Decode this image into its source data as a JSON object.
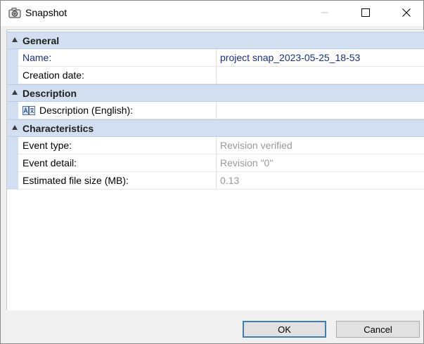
{
  "window": {
    "title": "Snapshot"
  },
  "grid": {
    "general": {
      "label": "General",
      "name_label": "Name:",
      "name_value": "project snap_2023-05-25_18-53",
      "creation_label": "Creation date:",
      "creation_value": ""
    },
    "description": {
      "label": "Description",
      "desc_label": "Description (English):",
      "desc_value": ""
    },
    "characteristics": {
      "label": "Characteristics",
      "event_type_label": "Event type:",
      "event_type_value": "Revision verified",
      "event_detail_label": "Event detail:",
      "event_detail_value": "Revision \"0\"",
      "file_size_label": "Estimated file size (MB):",
      "file_size_value": "0.13"
    }
  },
  "footer": {
    "ok_label": "OK",
    "cancel_label": "Cancel"
  },
  "colors": {
    "category_band": "#d1dff0",
    "name_blue": "#1a2f8a",
    "readonly_gray": "#9a9a9a",
    "ok_border": "#3c7fb1"
  }
}
